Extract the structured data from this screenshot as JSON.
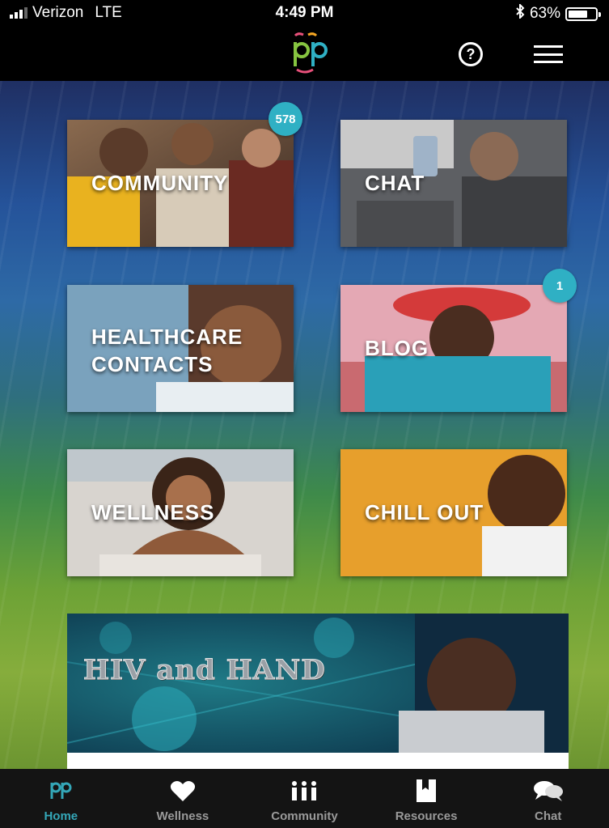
{
  "status": {
    "carrier": "Verizon",
    "network": "LTE",
    "time": "4:49 PM",
    "battery": "63%",
    "battery_level": 0.63
  },
  "nav": {
    "logo_icon": "pp-logo-icon",
    "help_icon": "?",
    "menu_icon": "hamburger-icon"
  },
  "tiles": [
    {
      "id": "community",
      "label": "COMMUNITY",
      "badge": "578"
    },
    {
      "id": "chat",
      "label": "CHAT"
    },
    {
      "id": "healthcare",
      "label_line1": "HEALTHCARE",
      "label_line2": "CONTACTS"
    },
    {
      "id": "blog",
      "label": "BLOG",
      "badge": "1"
    },
    {
      "id": "wellness",
      "label": "WELLNESS"
    },
    {
      "id": "chill",
      "label": "CHILL OUT"
    }
  ],
  "banner": {
    "title": "HIV and HAND"
  },
  "tabbar": {
    "items": [
      {
        "label": "Home",
        "icon": "pp-logo-icon",
        "active": true
      },
      {
        "label": "Wellness",
        "icon": "heart-icon"
      },
      {
        "label": "Community",
        "icon": "people-icon"
      },
      {
        "label": "Resources",
        "icon": "bookmark-icon"
      },
      {
        "label": "Chat",
        "icon": "chat-bubbles-icon"
      }
    ]
  },
  "colors": {
    "accent": "#34a7b8",
    "badge": "#2fb0c4",
    "tabbar": "#141414"
  }
}
